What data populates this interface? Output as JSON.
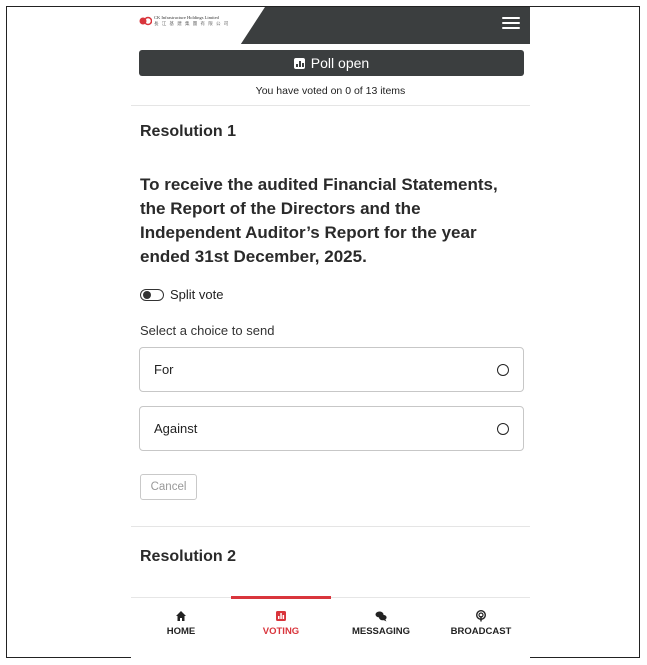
{
  "header": {
    "logo_line1": "CK Infrastructure Holdings Limited",
    "logo_line2": "長 江 基 建 集 團 有 限 公 司",
    "menu_icon": "hamburger-menu-icon"
  },
  "poll": {
    "status": "Poll open",
    "voted_summary": "You have voted on 0 of 13 items"
  },
  "resolution1": {
    "title": "Resolution 1",
    "text": "To receive the audited Financial Statements, the Report of the Directors and the Independent Auditor’s Report for the year ended 31st December, 2025.",
    "split_vote_label": "Split vote",
    "select_label": "Select a choice to send",
    "choices": [
      "For",
      "Against"
    ],
    "cancel_label": "Cancel"
  },
  "resolution2": {
    "title": "Resolution 2"
  },
  "nav": {
    "items": [
      {
        "label": "HOME",
        "icon": "home-icon"
      },
      {
        "label": "VOTING",
        "icon": "voting-icon"
      },
      {
        "label": "MESSAGING",
        "icon": "messaging-icon"
      },
      {
        "label": "BROADCAST",
        "icon": "broadcast-icon"
      }
    ],
    "active": "VOTING"
  },
  "colors": {
    "dark_bar": "#3b3e3f",
    "accent": "#d9353c"
  }
}
